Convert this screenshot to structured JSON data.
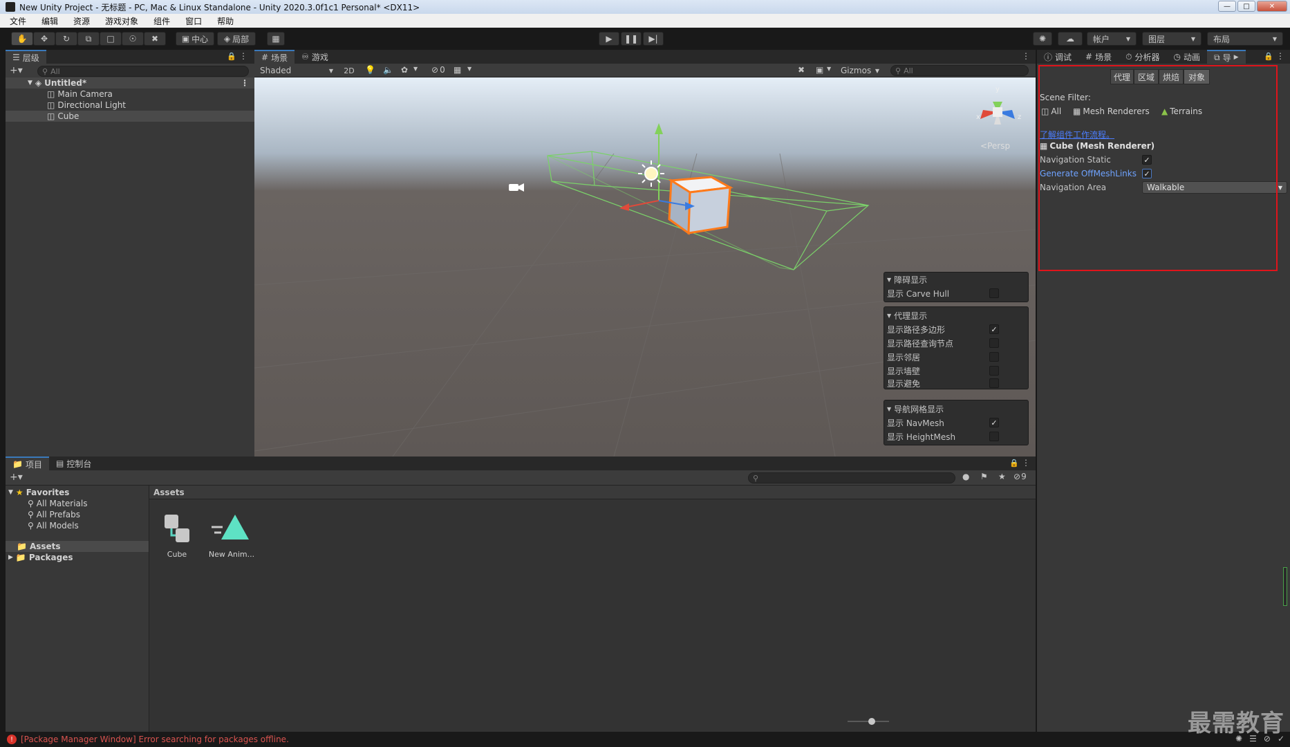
{
  "window": {
    "title": "New Unity Project - 无标题 - PC, Mac & Linux Standalone - Unity 2020.3.0f1c1 Personal* <DX11>"
  },
  "menu": [
    "文件",
    "编辑",
    "资源",
    "游戏对象",
    "组件",
    "窗口",
    "帮助"
  ],
  "toolbar": {
    "pivot_label": "中心",
    "space_label": "局部",
    "account_label": "帐户",
    "layers_label": "图层",
    "layout_label": "布局"
  },
  "hierarchy": {
    "tab_label": "层级",
    "search_placeholder": "All",
    "scene_name": "Untitled*",
    "items": [
      "Main Camera",
      "Directional Light",
      "Cube"
    ]
  },
  "scene": {
    "tabs": [
      "场景",
      "游戏"
    ],
    "shading_mode": "Shaded",
    "mode_2d": "2D",
    "hidden_count": "0",
    "gizmos_label": "Gizmos",
    "search_placeholder": "All",
    "persp_label": "Persp",
    "axis_labels": [
      "y",
      "x",
      "z"
    ],
    "obstacles": {
      "header": "障碍显示",
      "rows": [
        {
          "label": "显示 Carve Hull",
          "checked": false
        }
      ]
    },
    "agents": {
      "header": "代理显示",
      "rows": [
        {
          "label": "显示路径多边形",
          "checked": true
        },
        {
          "label": "显示路径查询节点",
          "checked": false
        },
        {
          "label": "显示邻居",
          "checked": false
        },
        {
          "label": "显示墙壁",
          "checked": false
        },
        {
          "label": "显示避免",
          "checked": false
        }
      ]
    },
    "navmesh": {
      "header": "导航网格显示",
      "rows": [
        {
          "label": "显示 NavMesh",
          "checked": true
        },
        {
          "label": "显示 HeightMesh",
          "checked": false
        }
      ]
    }
  },
  "right_panel": {
    "tabs": [
      "调试",
      "场景",
      "分析器",
      "动画",
      "导"
    ],
    "nav_tabs": [
      "代理",
      "区域",
      "烘焙",
      "对象"
    ],
    "active_nav_tab": "对象",
    "scene_filter_label": "Scene Filter:",
    "filters": [
      "All",
      "Mesh Renderers",
      "Terrains"
    ],
    "learn_link": "了解组件工作流程。",
    "object_title": "Cube (Mesh Renderer)",
    "navigation_static_label": "Navigation Static",
    "navigation_static": true,
    "generate_offmesh_label": "Generate OffMeshLinks",
    "generate_offmesh": true,
    "navigation_area_label": "Navigation Area",
    "navigation_area_value": "Walkable",
    "highlight_color": "#e0141b"
  },
  "project": {
    "tabs": [
      "项目",
      "控制台"
    ],
    "favorites_label": "Favorites",
    "favorites": [
      "All Materials",
      "All Prefabs",
      "All Models"
    ],
    "folders": [
      "Assets",
      "Packages"
    ],
    "breadcrumb": "Assets",
    "assets": [
      {
        "name": "Cube",
        "icon": "prefab-icon"
      },
      {
        "name": "New Anim...",
        "icon": "animation-icon"
      }
    ],
    "hidden_packages_count": "9"
  },
  "status": {
    "message": "[Package Manager Window] Error searching for packages offline."
  },
  "watermark": "最需教育"
}
